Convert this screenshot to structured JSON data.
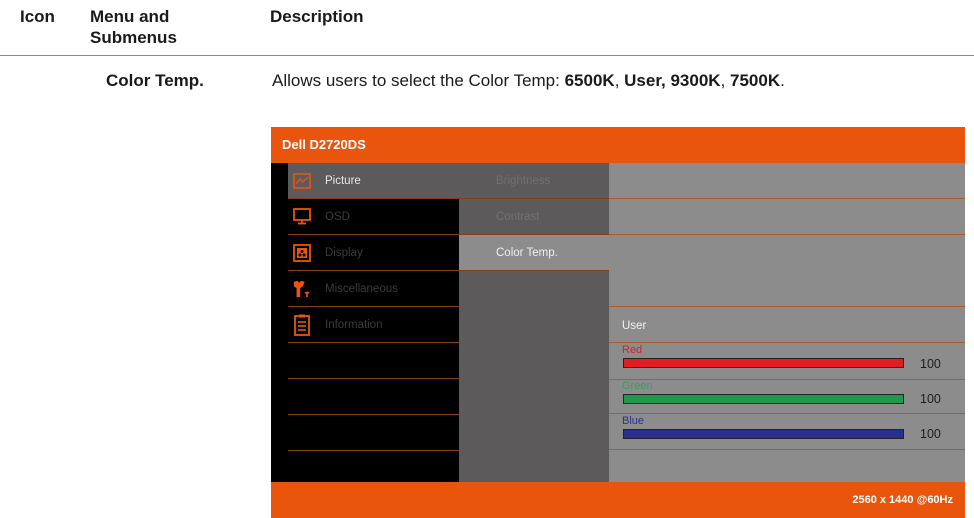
{
  "table": {
    "header": {
      "icon": "Icon",
      "menu": "Menu and Submenus",
      "description": "Description"
    },
    "row": {
      "menu": "Color Temp.",
      "desc_prefix": "Allows users to select the Color Temp: ",
      "opt1": "6500K",
      "sep1": ", ",
      "opt2": "User, 9300K",
      "sep2": ", ",
      "opt3": "7500K",
      "end": "."
    }
  },
  "osd": {
    "title": "Dell D2720DS",
    "footer": "2560 x 1440 @60Hz",
    "accent": "#e9550c",
    "main_menu": [
      {
        "label": "Picture",
        "icon": "picture-icon",
        "selected": true
      },
      {
        "label": "OSD",
        "icon": "monitor-icon",
        "selected": false
      },
      {
        "label": "Display",
        "icon": "display-icon",
        "selected": false
      },
      {
        "label": "Miscellaneous",
        "icon": "wrench-icon",
        "selected": false
      },
      {
        "label": "Information",
        "icon": "clipboard-icon",
        "selected": false
      }
    ],
    "submenu": [
      {
        "label": "Brightness",
        "selected": false
      },
      {
        "label": "Contrast",
        "selected": false
      },
      {
        "label": "Color Temp.",
        "selected": true
      }
    ],
    "current_preset": "User",
    "channels": [
      {
        "name": "Red",
        "value": "100",
        "color": "#e31b23",
        "label_color": "#e31b23",
        "level": 1.0
      },
      {
        "name": "Green",
        "value": "100",
        "color": "#1f9a4a",
        "label_color": "#2aa85a",
        "level": 1.0
      },
      {
        "name": "Blue",
        "value": "100",
        "color": "#2a2f8f",
        "label_color": "#2e3192",
        "level": 1.0
      }
    ]
  }
}
